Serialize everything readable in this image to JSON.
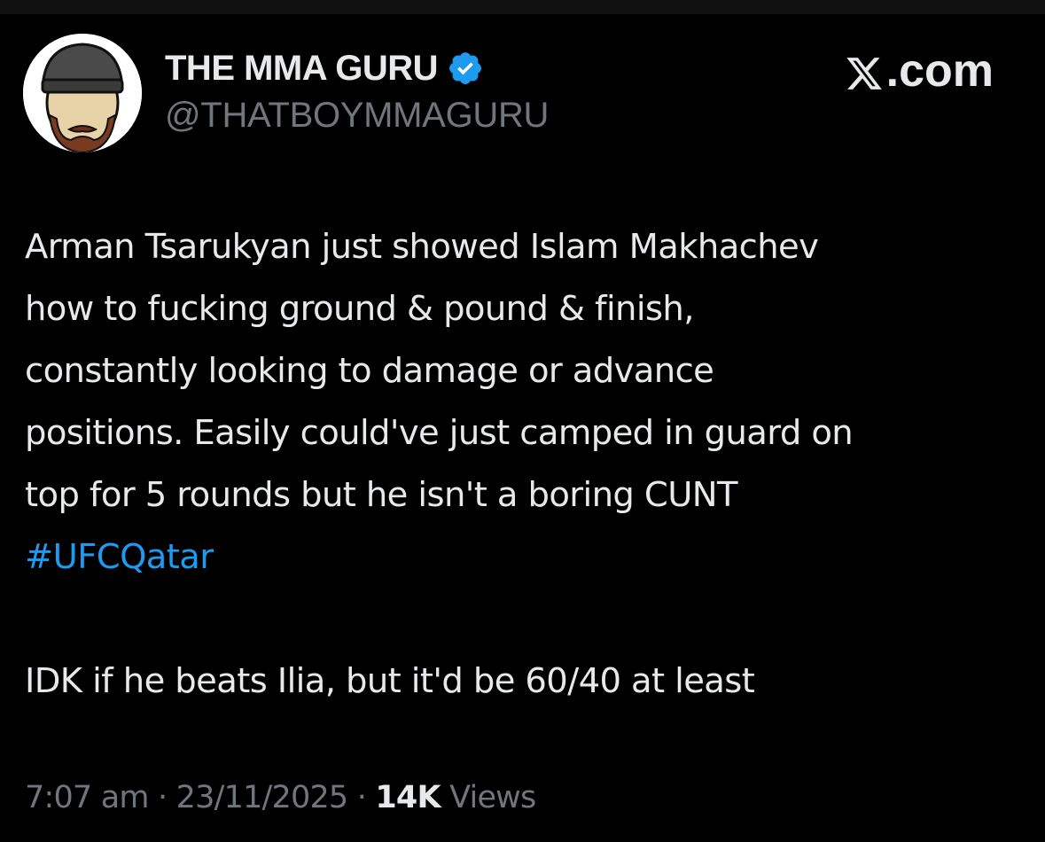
{
  "author": {
    "display_name": "THE MMA GURU",
    "handle": "@THATBOYMMAGURU",
    "verified_icon": "verified-badge-icon",
    "verified_color": "#1d9bf0",
    "avatar_icon": "cartoon-bearded-face-with-beanie"
  },
  "brand": {
    "icon": "x-logo-icon",
    "domain_suffix": ".com"
  },
  "tweet": {
    "lines": [
      "Arman Tsarukyan just showed Islam Makhachev",
      "how to fucking ground & pound & finish,",
      "constantly looking to damage or advance",
      "positions. Easily could've just camped in guard on",
      "top for 5 rounds but he isn't a boring CUNT"
    ],
    "hashtag": "#UFCQatar",
    "followup": "IDK if he beats Ilia, but it'd be 60/40 at least"
  },
  "meta": {
    "time": "7:07 am",
    "separator": "·",
    "date": "23/11/2025",
    "views_count": "14K",
    "views_label": "Views"
  },
  "colors": {
    "background": "#000000",
    "text": "#e7e9ea",
    "secondary": "#71767b",
    "link": "#1d9bf0"
  }
}
